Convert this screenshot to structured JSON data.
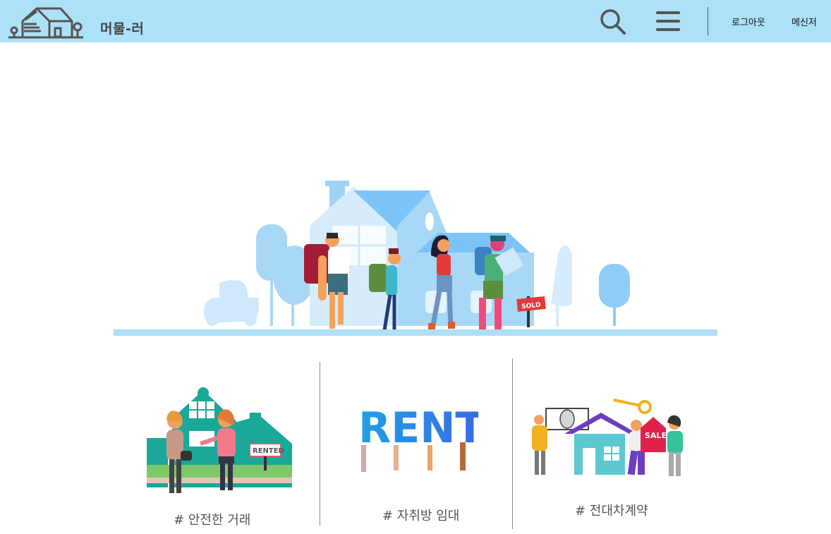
{
  "header": {
    "site_name": "머물-러",
    "logout_label": "로그아웃",
    "messenger_label": "메신저"
  },
  "icons": {
    "logo": "house-logo-icon",
    "search": "search-icon",
    "menu": "hamburger-menu-icon"
  },
  "colors": {
    "header_bg": "#ade1f8",
    "ground": "#aee0f7"
  },
  "cards": [
    {
      "caption": "# 안전한 거래",
      "sign_text": "RENTED"
    },
    {
      "caption": "# 자취방 임대",
      "banner_text": "RENT"
    },
    {
      "caption": "# 전대차계약",
      "sign_text": "SALE"
    }
  ],
  "hero": {
    "sign_text": "SOLD"
  }
}
